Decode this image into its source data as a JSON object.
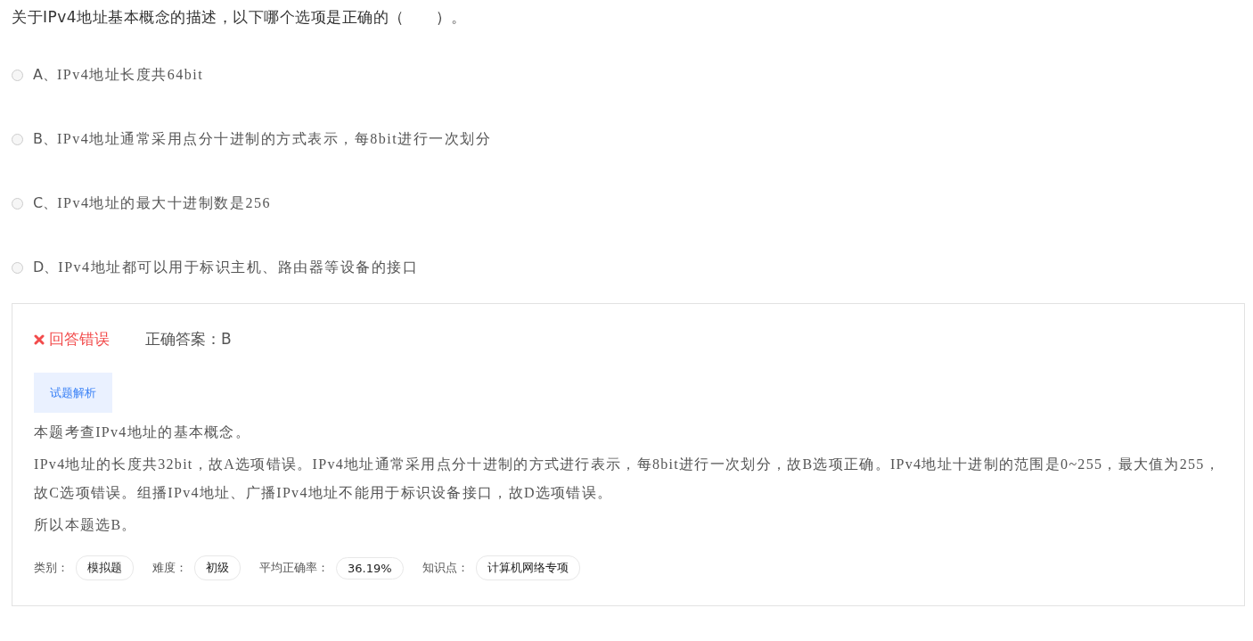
{
  "question": "关于IPv4地址基本概念的描述，以下哪个选项是正确的（　　）。",
  "options": [
    {
      "letter": "A、",
      "text": "IPv4地址长度共64bit",
      "selected": false
    },
    {
      "letter": "B、",
      "text": "IPv4地址通常采用点分十进制的方式表示，每8bit进行一次划分",
      "selected": false
    },
    {
      "letter": "C、",
      "text": "IPv4地址的最大十进制数是256",
      "selected": false
    },
    {
      "letter": "D、",
      "text": "IPv4地址都可以用于标识主机、路由器等设备的接口",
      "selected": false
    }
  ],
  "result": {
    "kind": "wrong",
    "label": "回答错误",
    "answer": "正确答案：B"
  },
  "tabs": [
    {
      "label": "试题解析",
      "selected": true
    }
  ],
  "analysis": [
    "本题考查IPv4地址的基本概念。",
    "IPv4地址的长度共32bit，故A选项错误。IPv4地址通常采用点分十进制的方式进行表示，每8bit进行一次划分，故B选项正确。IPv4地址十进制的范围是0~255，最大值为255，故C选项错误。组播IPv4地址、广播IPv4地址不能用于标识设备接口，故D选项错误。",
    "所以本题选B。"
  ],
  "meta": [
    {
      "label": "类别：",
      "value": "模拟题"
    },
    {
      "label": "难度：",
      "value": "初级"
    },
    {
      "label": "平均正确率：",
      "value": "36.19%"
    },
    {
      "label": "知识点：",
      "value": "计算机网络专项"
    }
  ]
}
